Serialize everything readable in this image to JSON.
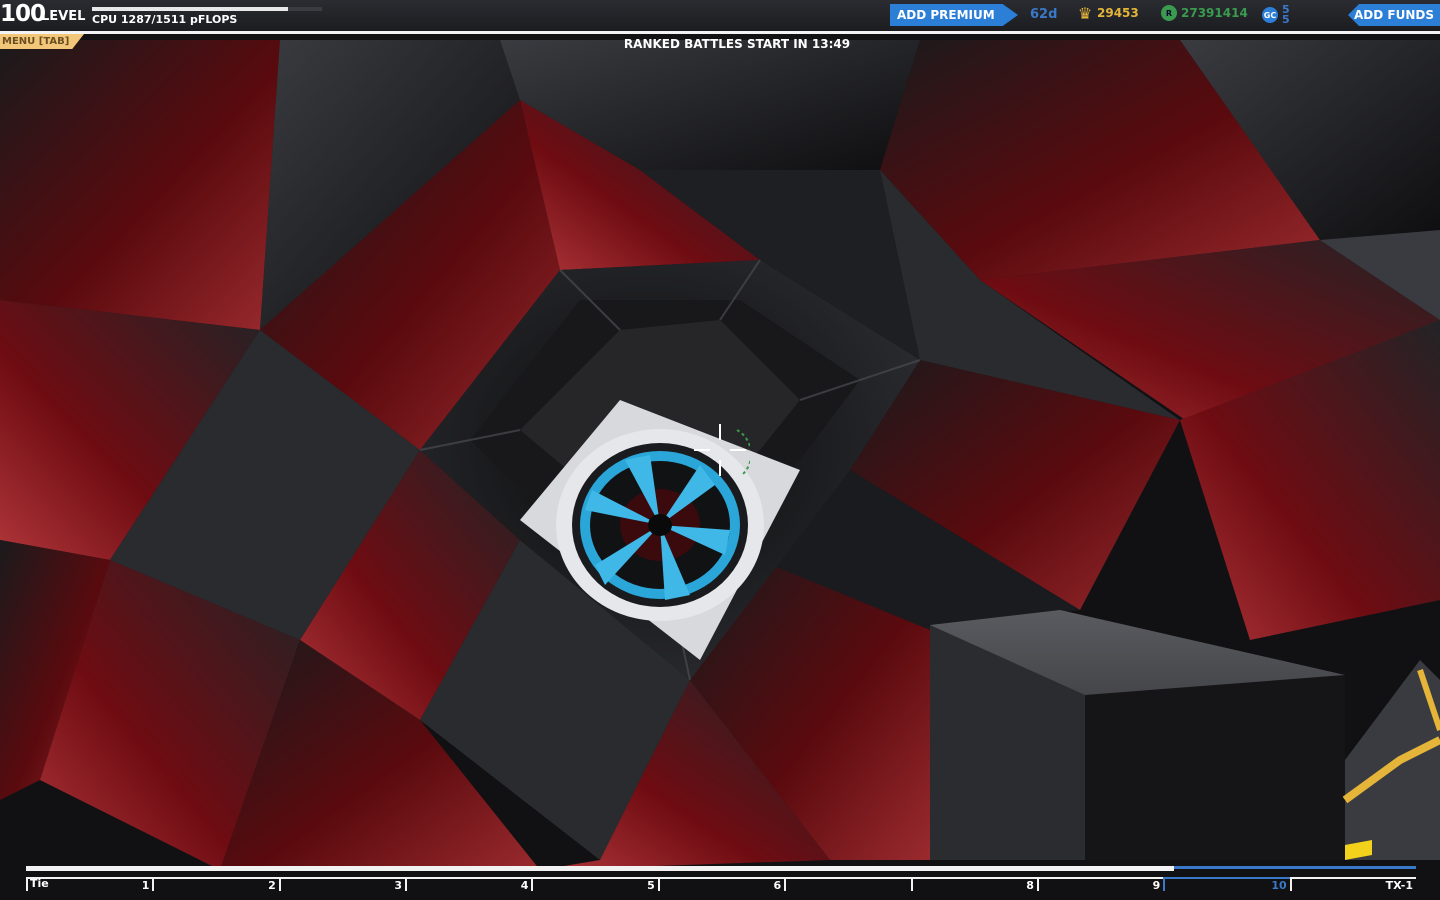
{
  "hud": {
    "level_number": "100",
    "level_label": "LEVEL",
    "cpu_text": "CPU 1287/1511 pFLOPS",
    "cpu_used": 1287,
    "cpu_max": 1511,
    "add_premium_label": "ADD PREMIUM",
    "premium_days": "62d",
    "trophies": "29453",
    "robits": "27391414",
    "gc_line1": "5",
    "gc_line2": "5",
    "add_funds_label": "ADD FUNDS",
    "menu_label": "MENU [TAB]",
    "ranked_message": "RANKED BATTLES START IN 13:49"
  },
  "hotbar": {
    "first_label": "Tie",
    "slots": [
      "1",
      "2",
      "3",
      "4",
      "5",
      "6",
      "",
      "8",
      "9",
      "10",
      "TX-1"
    ],
    "selected_index": 9
  },
  "colors": {
    "accent_blue": "#2b7fd6",
    "menu_orange": "#f2c77a",
    "trophy_gold": "#e5b53a",
    "robits_green": "#3a9b4e",
    "cube_red": "#7a0d12",
    "engine_blue": "#2aa6d8"
  },
  "icons": {
    "trophy": "trophy-icon",
    "robits": "robits-icon",
    "gc": "galaxy-coin-icon"
  }
}
